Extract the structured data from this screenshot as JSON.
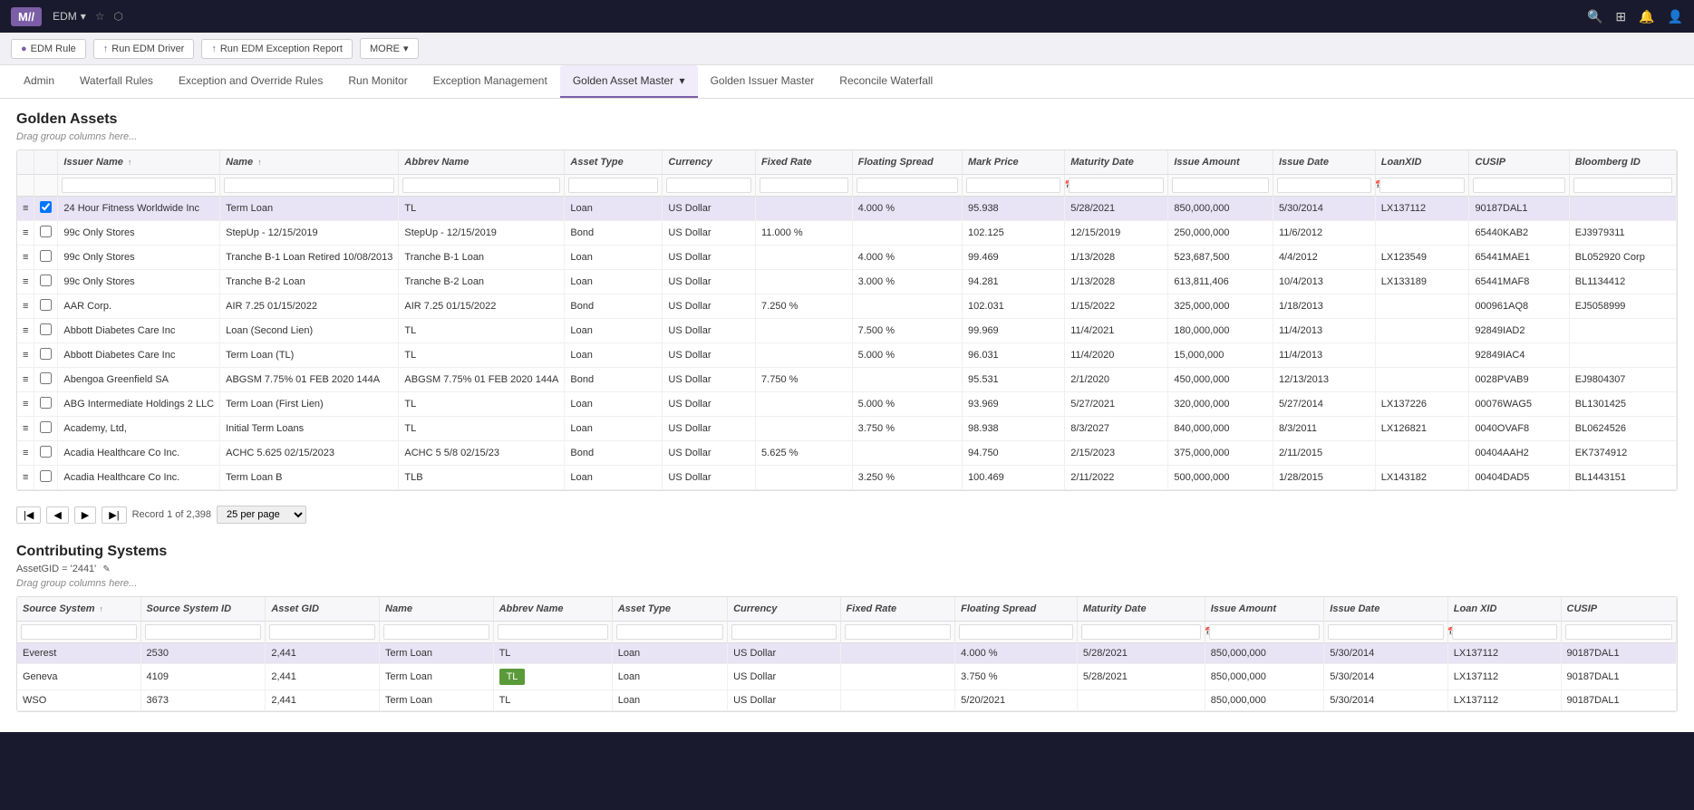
{
  "topbar": {
    "logo": "M",
    "app": "EDM",
    "icons": [
      "search",
      "grid",
      "bell",
      "user"
    ]
  },
  "action_bar": {
    "buttons": [
      {
        "label": "EDM Rule",
        "icon": "●"
      },
      {
        "label": "Run EDM Driver",
        "icon": "↑"
      },
      {
        "label": "Run EDM Exception Report",
        "icon": "↑"
      },
      {
        "label": "MORE",
        "icon": "▾"
      }
    ]
  },
  "nav_tabs": [
    {
      "label": "Admin"
    },
    {
      "label": "Waterfall Rules"
    },
    {
      "label": "Exception and Override Rules"
    },
    {
      "label": "Run Monitor"
    },
    {
      "label": "Exception Management"
    },
    {
      "label": "Golden Asset Master",
      "active": true
    },
    {
      "label": "Golden Issuer Master"
    },
    {
      "label": "Reconcile Waterfall"
    }
  ],
  "golden_assets": {
    "title": "Golden Assets",
    "drag_hint": "Drag group columns here...",
    "columns": [
      {
        "label": "Issuer Name",
        "sort": "↑"
      },
      {
        "label": "Name",
        "sort": "↑"
      },
      {
        "label": "Abbrev Name"
      },
      {
        "label": "Asset Type"
      },
      {
        "label": "Currency"
      },
      {
        "label": "Fixed Rate"
      },
      {
        "label": "Floating Spread"
      },
      {
        "label": "Mark Price"
      },
      {
        "label": "Maturity Date"
      },
      {
        "label": "Issue Amount"
      },
      {
        "label": "Issue Date"
      },
      {
        "label": "LoanXID"
      },
      {
        "label": "CUSIP"
      },
      {
        "label": "Bloomberg ID"
      }
    ],
    "rows": [
      {
        "selected": true,
        "issuer": "24 Hour Fitness Worldwide Inc",
        "name": "Term Loan",
        "abbrev": "TL",
        "asset_type": "Loan",
        "currency": "US Dollar",
        "fixed": "",
        "floating": "4.000 %",
        "mark": "95.938",
        "maturity": "5/28/2021",
        "issue_amount": "850,000,000",
        "issue_date": "5/30/2014",
        "loanxid": "LX137112",
        "cusip": "90187DAL1",
        "bloomberg": ""
      },
      {
        "selected": false,
        "issuer": "99c Only Stores",
        "name": "StepUp - 12/15/2019",
        "abbrev": "StepUp - 12/15/2019",
        "asset_type": "Bond",
        "currency": "US Dollar",
        "fixed": "11.000 %",
        "floating": "",
        "mark": "102.125",
        "maturity": "12/15/2019",
        "issue_amount": "250,000,000",
        "issue_date": "11/6/2012",
        "loanxid": "",
        "cusip": "65440KAB2",
        "bloomberg": "EJ3979311"
      },
      {
        "selected": false,
        "issuer": "99c Only Stores",
        "name": "Tranche B-1 Loan Retired 10/08/2013",
        "abbrev": "Tranche B-1 Loan",
        "asset_type": "Loan",
        "currency": "US Dollar",
        "fixed": "",
        "floating": "4.000 %",
        "mark": "99.469",
        "maturity": "1/13/2028",
        "issue_amount": "523,687,500",
        "issue_date": "4/4/2012",
        "loanxid": "LX123549",
        "cusip": "65441MAE1",
        "bloomberg": "BL052920 Corp"
      },
      {
        "selected": false,
        "issuer": "99c Only Stores",
        "name": "Tranche B-2 Loan",
        "abbrev": "Tranche B-2 Loan",
        "asset_type": "Loan",
        "currency": "US Dollar",
        "fixed": "",
        "floating": "3.000 %",
        "mark": "94.281",
        "maturity": "1/13/2028",
        "issue_amount": "613,811,406",
        "issue_date": "10/4/2013",
        "loanxid": "LX133189",
        "cusip": "65441MAF8",
        "bloomberg": "BL1134412"
      },
      {
        "selected": false,
        "issuer": "AAR Corp.",
        "name": "AIR 7.25 01/15/2022",
        "abbrev": "AIR 7.25 01/15/2022",
        "asset_type": "Bond",
        "currency": "US Dollar",
        "fixed": "7.250 %",
        "floating": "",
        "mark": "102.031",
        "maturity": "1/15/2022",
        "issue_amount": "325,000,000",
        "issue_date": "1/18/2013",
        "loanxid": "",
        "cusip": "000961AQ8",
        "bloomberg": "EJ5058999"
      },
      {
        "selected": false,
        "issuer": "Abbott Diabetes Care Inc",
        "name": "Loan (Second Lien)",
        "abbrev": "TL",
        "asset_type": "Loan",
        "currency": "US Dollar",
        "fixed": "",
        "floating": "7.500 %",
        "mark": "99.969",
        "maturity": "11/4/2021",
        "issue_amount": "180,000,000",
        "issue_date": "11/4/2013",
        "loanxid": "",
        "cusip": "92849IAD2",
        "bloomberg": ""
      },
      {
        "selected": false,
        "issuer": "Abbott Diabetes Care Inc",
        "name": "Term Loan (TL)",
        "abbrev": "TL",
        "asset_type": "Loan",
        "currency": "US Dollar",
        "fixed": "",
        "floating": "5.000 %",
        "mark": "96.031",
        "maturity": "11/4/2020",
        "issue_amount": "15,000,000",
        "issue_date": "11/4/2013",
        "loanxid": "",
        "cusip": "92849IAC4",
        "bloomberg": ""
      },
      {
        "selected": false,
        "issuer": "Abengoa Greenfield SA",
        "name": "ABGSM 7.75% 01 FEB 2020 144A",
        "abbrev": "ABGSM 7.75% 01 FEB 2020 144A",
        "asset_type": "Bond",
        "currency": "US Dollar",
        "fixed": "7.750 %",
        "floating": "",
        "mark": "95.531",
        "maturity": "2/1/2020",
        "issue_amount": "450,000,000",
        "issue_date": "12/13/2013",
        "loanxid": "",
        "cusip": "0028PVAB9",
        "bloomberg": "EJ9804307"
      },
      {
        "selected": false,
        "issuer": "ABG Intermediate Holdings 2 LLC",
        "name": "Term Loan (First Lien)",
        "abbrev": "TL",
        "asset_type": "Loan",
        "currency": "US Dollar",
        "fixed": "",
        "floating": "5.000 %",
        "mark": "93.969",
        "maturity": "5/27/2021",
        "issue_amount": "320,000,000",
        "issue_date": "5/27/2014",
        "loanxid": "LX137226",
        "cusip": "00076WAG5",
        "bloomberg": "BL1301425"
      },
      {
        "selected": false,
        "issuer": "Academy, Ltd,",
        "name": "Initial Term Loans",
        "abbrev": "TL",
        "asset_type": "Loan",
        "currency": "US Dollar",
        "fixed": "",
        "floating": "3.750 %",
        "mark": "98.938",
        "maturity": "8/3/2027",
        "issue_amount": "840,000,000",
        "issue_date": "8/3/2011",
        "loanxid": "LX126821",
        "cusip": "0040OVAF8",
        "bloomberg": "BL0624526"
      },
      {
        "selected": false,
        "issuer": "Acadia Healthcare Co Inc.",
        "name": "ACHC 5.625 02/15/2023",
        "abbrev": "ACHC 5 5/8 02/15/23",
        "asset_type": "Bond",
        "currency": "US Dollar",
        "fixed": "5.625 %",
        "floating": "",
        "mark": "94.750",
        "maturity": "2/15/2023",
        "issue_amount": "375,000,000",
        "issue_date": "2/11/2015",
        "loanxid": "",
        "cusip": "00404AAH2",
        "bloomberg": "EK7374912"
      },
      {
        "selected": false,
        "issuer": "Acadia Healthcare Co Inc.",
        "name": "Term Loan B",
        "abbrev": "TLB",
        "asset_type": "Loan",
        "currency": "US Dollar",
        "fixed": "",
        "floating": "3.250 %",
        "mark": "100.469",
        "maturity": "2/11/2022",
        "issue_amount": "500,000,000",
        "issue_date": "1/28/2015",
        "loanxid": "LX143182",
        "cusip": "00404DAD5",
        "bloomberg": "BL1443151"
      }
    ],
    "pagination": {
      "record_text": "Record 1 of 2,398",
      "per_page": "25 per page"
    }
  },
  "contributing_systems": {
    "title": "Contributing Systems",
    "assetgid_label": "AssetGID = '2441'",
    "drag_hint": "Drag group columns here...",
    "columns": [
      {
        "label": "Source System",
        "sort": "↑"
      },
      {
        "label": "Source System ID"
      },
      {
        "label": "Asset GID"
      },
      {
        "label": "Name"
      },
      {
        "label": "Abbrev Name"
      },
      {
        "label": "Asset Type"
      },
      {
        "label": "Currency"
      },
      {
        "label": "Fixed Rate"
      },
      {
        "label": "Floating Spread"
      },
      {
        "label": "Maturity Date"
      },
      {
        "label": "Issue Amount"
      },
      {
        "label": "Issue Date"
      },
      {
        "label": "Loan XID"
      },
      {
        "label": "CUSIP"
      }
    ],
    "rows": [
      {
        "selected": true,
        "source": "Everest",
        "source_id": "2530",
        "asset_gid": "2,441",
        "name": "Term Loan",
        "abbrev": "TL",
        "asset_type": "Loan",
        "currency": "US Dollar",
        "fixed": "",
        "floating": "4.000 %",
        "maturity": "5/28/2021",
        "issue_amount": "850,000,000",
        "issue_date": "5/30/2014",
        "loanxid": "LX137112",
        "cusip": "90187DAL1"
      },
      {
        "selected": false,
        "source": "Geneva",
        "source_id": "4109",
        "asset_gid": "2,441",
        "name": "Term Loan",
        "abbrev": "TL_green",
        "asset_type": "Loan",
        "currency": "US Dollar",
        "fixed": "",
        "floating": "3.750 %",
        "maturity": "5/28/2021",
        "issue_amount": "850,000,000",
        "issue_date": "5/30/2014",
        "loanxid": "LX137112",
        "cusip": "90187DAL1"
      },
      {
        "selected": false,
        "source": "WSO",
        "source_id": "3673",
        "asset_gid": "2,441",
        "name": "Term Loan",
        "abbrev": "TL",
        "asset_type": "Loan",
        "currency": "US Dollar",
        "fixed": "",
        "floating": "5/20/2021",
        "maturity": "",
        "issue_amount": "850,000,000",
        "issue_date": "5/30/2014",
        "loanxid": "LX137112",
        "cusip": "90187DAL1"
      }
    ]
  }
}
